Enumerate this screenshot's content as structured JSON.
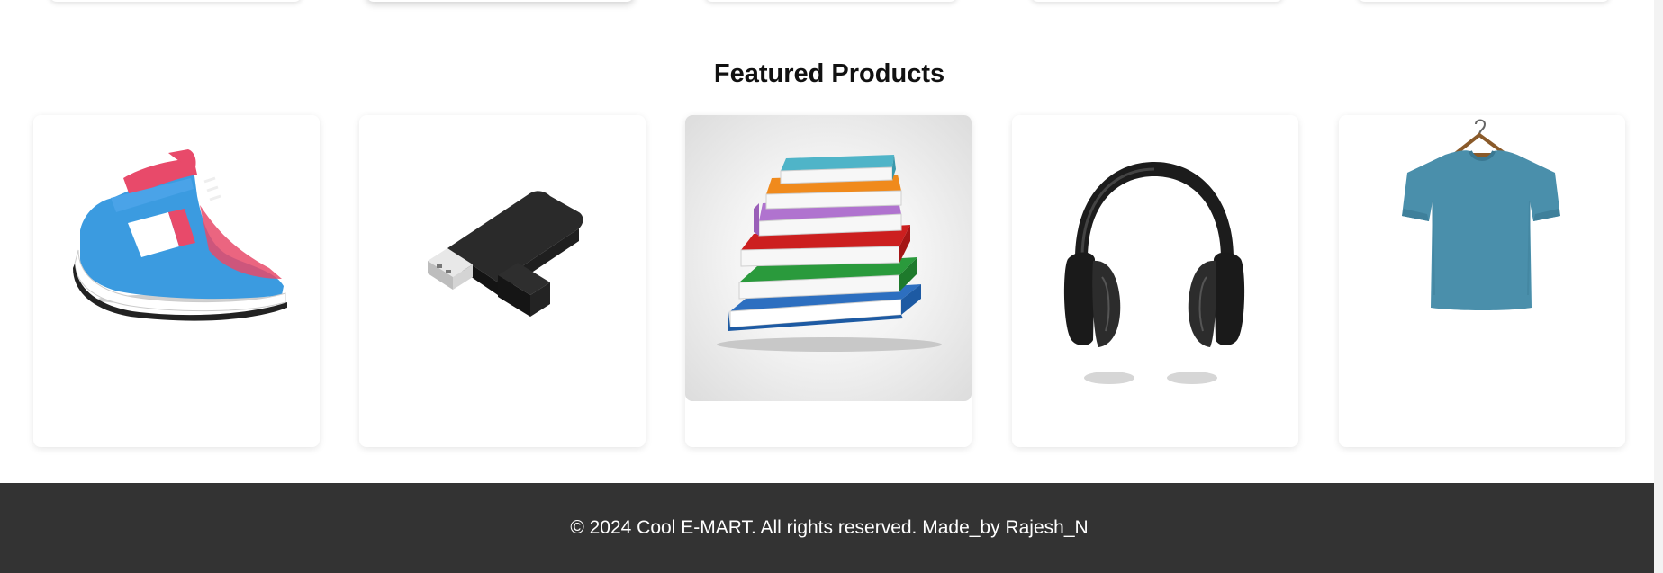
{
  "featured": {
    "title": "Featured Products",
    "products": [
      {
        "icon": "sneaker-icon"
      },
      {
        "icon": "usb-drive-icon"
      },
      {
        "icon": "books-icon"
      },
      {
        "icon": "headphones-icon"
      },
      {
        "icon": "tshirt-icon"
      }
    ]
  },
  "footer": {
    "text": "© 2024 Cool E-MART. All rights reserved. Made_by Rajesh_N"
  },
  "colors": {
    "footer_bg": "#333333",
    "footer_text": "#ffffff",
    "title": "#111111"
  }
}
